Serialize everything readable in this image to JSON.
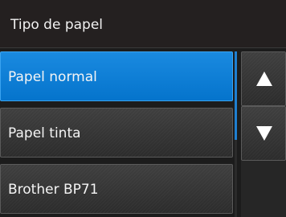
{
  "header": {
    "title": "Tipo de papel"
  },
  "list": {
    "items": [
      {
        "label": "Papel normal",
        "selected": true
      },
      {
        "label": "Papel tinta",
        "selected": false
      },
      {
        "label": "Brother BP71",
        "selected": false
      }
    ]
  },
  "nav": {
    "up_icon": "triangle-up-icon",
    "down_icon": "triangle-down-icon"
  },
  "colors": {
    "accent": "#0a7ed6",
    "background": "#1c1c1c"
  }
}
